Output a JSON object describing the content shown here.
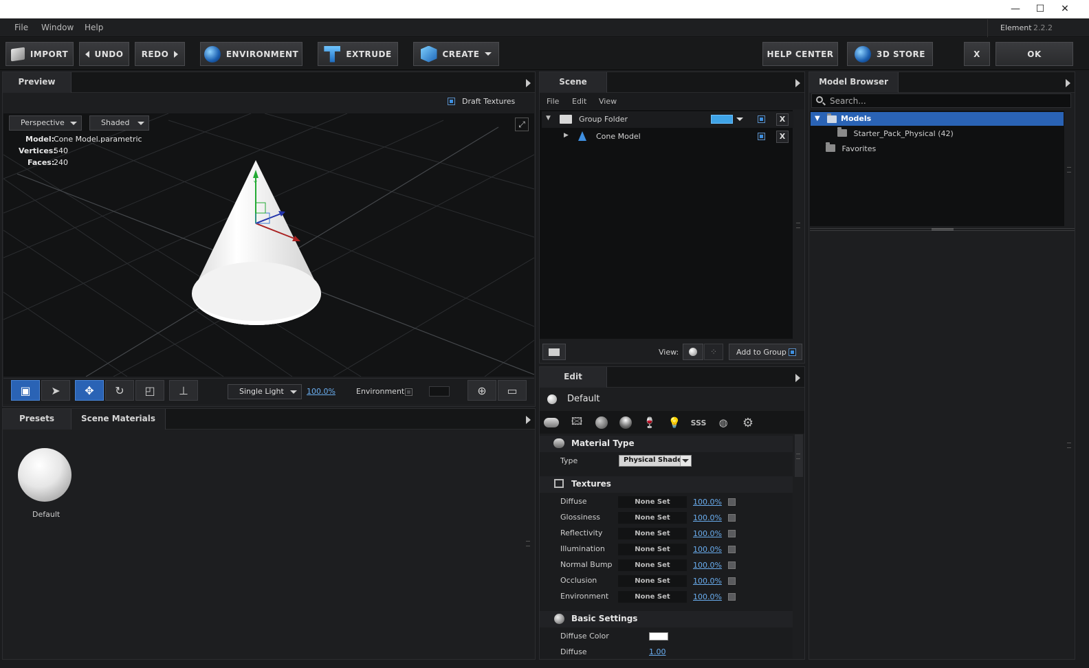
{
  "menubar": {
    "file": "File",
    "window": "Window",
    "help": "Help",
    "app_name": "Element",
    "app_version": "2.2.2"
  },
  "toolbar": {
    "import": "IMPORT",
    "undo": "UNDO",
    "redo": "REDO",
    "environment": "ENVIRONMENT",
    "extrude": "EXTRUDE",
    "create": "CREATE",
    "help_center": "HELP CENTER",
    "store": "3D STORE",
    "close": "X",
    "ok": "OK"
  },
  "preview": {
    "tab": "Preview",
    "draft_textures": "Draft Textures",
    "camera": "Perspective",
    "shading": "Shaded",
    "model_label": "Model:",
    "model_value": "Cone Model.parametric",
    "vertices_label": "Vertices:",
    "vertices_value": "540",
    "faces_label": "Faces:",
    "faces_value": "240",
    "lighting": "Single Light",
    "light_pct": "100.0%",
    "environment": "Environment"
  },
  "presets": {
    "tab_presets": "Presets",
    "tab_materials": "Scene Materials",
    "item_label": "Default"
  },
  "scene": {
    "tab": "Scene",
    "menu": [
      "File",
      "Edit",
      "View"
    ],
    "group_folder": "Group Folder",
    "cone_model": "Cone Model",
    "x": "X",
    "view_label": "View:",
    "add_to_group": "Add to Group"
  },
  "model_browser": {
    "tab": "Model Browser",
    "search_placeholder": "Search...",
    "models": "Models",
    "starter_pack": "Starter_Pack_Physical (42)",
    "favorites": "Favorites"
  },
  "edit": {
    "tab": "Edit",
    "material_name": "Default",
    "material_type_title": "Material Type",
    "type_label": "Type",
    "type_value": "Physical Shader",
    "textures_title": "Textures",
    "textures": [
      {
        "name": "Diffuse",
        "value": "None Set",
        "pct": "100.0%"
      },
      {
        "name": "Glossiness",
        "value": "None Set",
        "pct": "100.0%"
      },
      {
        "name": "Reflectivity",
        "value": "None Set",
        "pct": "100.0%"
      },
      {
        "name": "Illumination",
        "value": "None Set",
        "pct": "100.0%"
      },
      {
        "name": "Normal Bump",
        "value": "None Set",
        "pct": "100.0%"
      },
      {
        "name": "Occlusion",
        "value": "None Set",
        "pct": "100.0%"
      },
      {
        "name": "Environment",
        "value": "None Set",
        "pct": "100.0%"
      }
    ],
    "basic_title": "Basic Settings",
    "diffuse_color_label": "Diffuse Color",
    "diffuse_label": "Diffuse",
    "diffuse_value": "1.00"
  },
  "colors": {
    "accent": "#2a63b5",
    "link": "#6aaef0",
    "background": "#1d1e20"
  }
}
